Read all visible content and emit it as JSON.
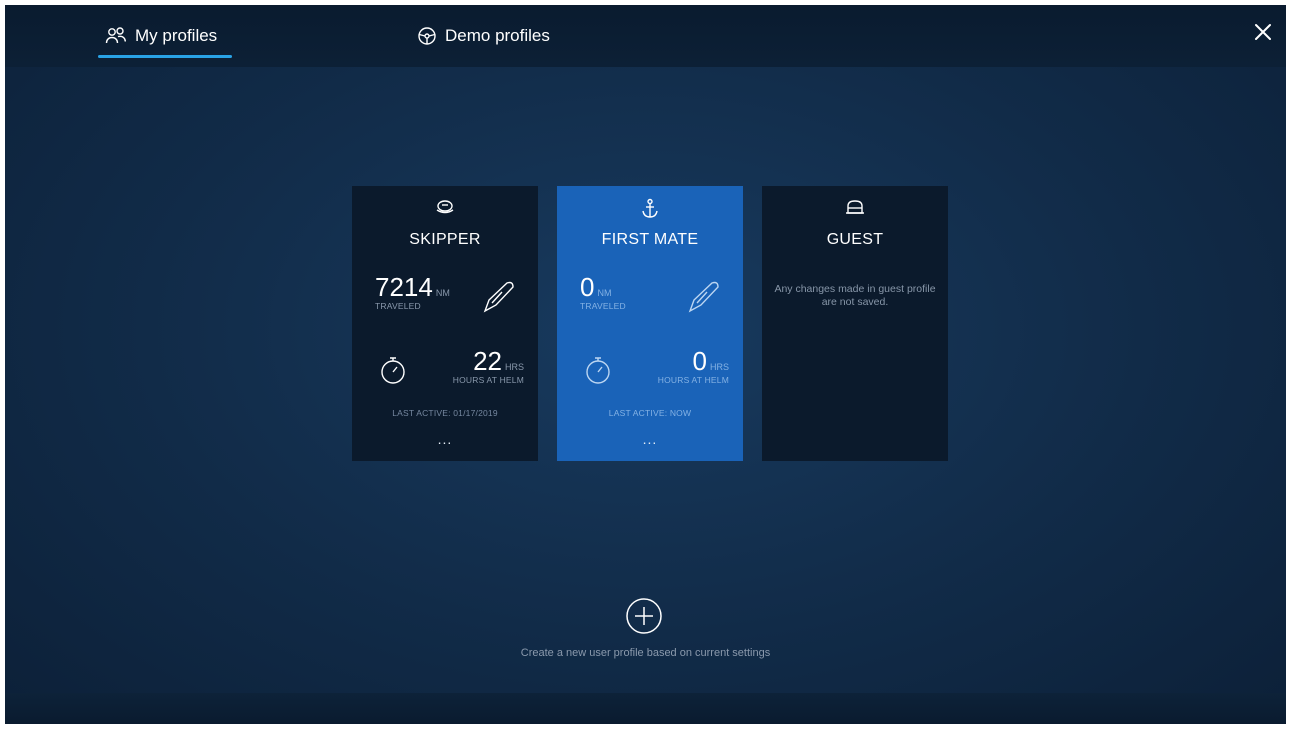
{
  "tabs": {
    "my_profiles": "My profiles",
    "demo_profiles": "Demo profiles"
  },
  "profiles": [
    {
      "role": "SKIPPER",
      "icon": "captain-hat-icon",
      "distance_value": "7214",
      "distance_unit": "NM",
      "distance_caption": "TRAVELED",
      "hours_value": "22",
      "hours_unit": "HRS",
      "hours_caption": "HOURS AT HELM",
      "last_active": "LAST ACTIVE: 01/17/2019",
      "more": "..."
    },
    {
      "role": "FIRST MATE",
      "icon": "anchor-icon",
      "selected": true,
      "distance_value": "0",
      "distance_unit": "NM",
      "distance_caption": "TRAVELED",
      "hours_value": "0",
      "hours_unit": "HRS",
      "hours_caption": "HOURS AT HELM",
      "last_active": "LAST ACTIVE: NOW",
      "more": "..."
    },
    {
      "role": "GUEST",
      "icon": "guest-cap-icon",
      "note": "Any changes made in guest profile are not saved."
    }
  ],
  "create": {
    "caption": "Create a new user profile based on current settings"
  },
  "colors": {
    "accent": "#29a3e6",
    "selected_card": "#1a63b8",
    "card": "#0b1a2c",
    "background": "#112b48"
  }
}
